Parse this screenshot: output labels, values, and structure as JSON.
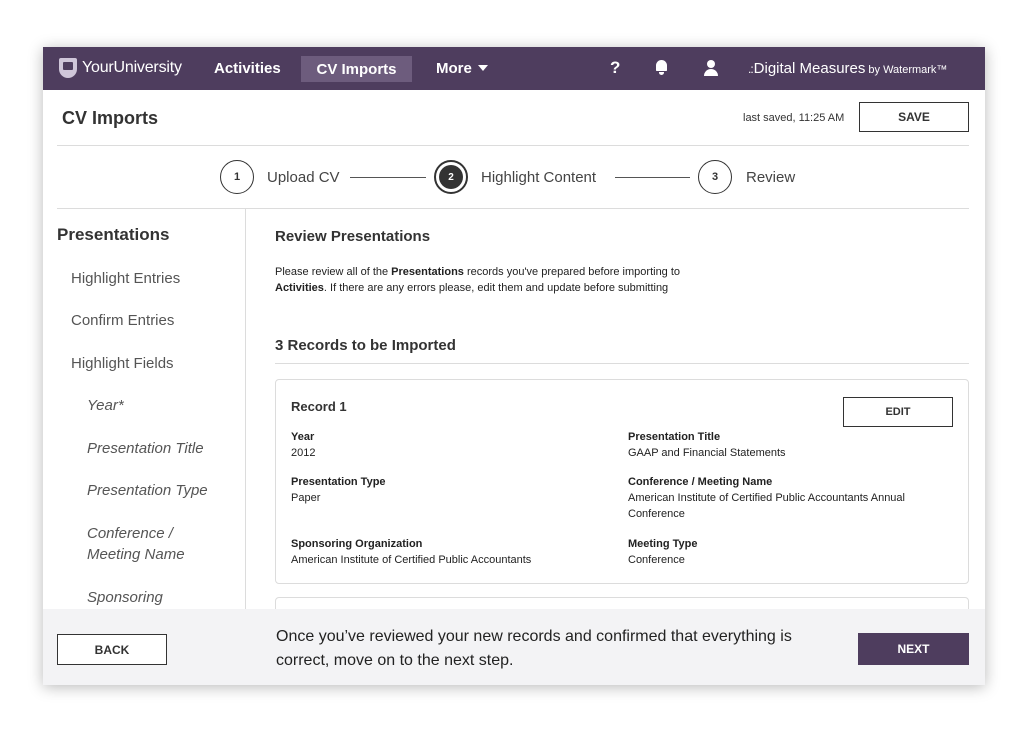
{
  "nav": {
    "logo_text": "YourUniversity",
    "items": [
      {
        "label": "Activities"
      },
      {
        "label": "CV Imports"
      },
      {
        "label": "More"
      }
    ],
    "help_glyph": "?",
    "brand_dots": ".:",
    "brand_text": "Digital Measures",
    "brand_by": "by Watermark™"
  },
  "header": {
    "title": "CV Imports",
    "last_saved": "last saved, 11:25 AM",
    "save_label": "SAVE"
  },
  "stepper": {
    "steps": [
      {
        "number": "1",
        "label": "Upload CV"
      },
      {
        "number": "2",
        "label": "Highlight Content"
      },
      {
        "number": "3",
        "label": "Review"
      }
    ]
  },
  "sidebar": {
    "title": "Presentations",
    "items": [
      "Highlight Entries",
      "Confirm Entries",
      "Highlight Fields"
    ],
    "subitems": [
      "Year*",
      "Presentation Title",
      "Presentation Type",
      "Conference / Meeting Name",
      "Sponsoring"
    ]
  },
  "main": {
    "title": "Review Presentations",
    "intro_1": "Please review all of the ",
    "intro_bold_1": "Presentations",
    "intro_2": " records you've prepared before importing to ",
    "intro_bold_2": "Activities",
    "intro_3": ". If there are any errors please, edit them and update before submitting",
    "records_count": "3 Records to be Imported",
    "record": {
      "title": "Record 1",
      "edit_label": "EDIT",
      "fields": [
        {
          "label": "Year",
          "value": "2012"
        },
        {
          "label": "Presentation Title",
          "value": "GAAP and Financial Statements"
        },
        {
          "label": "Presentation Type",
          "value": "Paper"
        },
        {
          "label": "Conference / Meeting Name",
          "value": "American Institute of Certified Public Accountants Annual Conference"
        },
        {
          "label": "Sponsoring Organization",
          "value": "American Institute of Certified Public Accountants"
        },
        {
          "label": "Meeting Type",
          "value": "Conference"
        }
      ]
    }
  },
  "footer": {
    "back_label": "BACK",
    "message": "Once you’ve reviewed your new records and confirmed that everything is correct, move on to the next step.",
    "next_label": "NEXT"
  },
  "colors": {
    "nav_bg": "#4e3d5e",
    "nav_active": "#6d5c7d",
    "footer_bg": "#f3f3f5"
  }
}
